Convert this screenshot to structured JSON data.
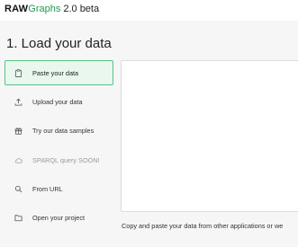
{
  "header": {
    "brand_raw": "RAW",
    "brand_graphs": "Graphs",
    "version": "2.0 beta"
  },
  "section": {
    "title": "1. Load your data"
  },
  "menu": {
    "items": [
      {
        "label": "Paste your data",
        "icon": "clipboard-icon",
        "state": "active"
      },
      {
        "label": "Upload your data",
        "icon": "upload-icon",
        "state": "normal"
      },
      {
        "label": "Try our data samples",
        "icon": "gift-icon",
        "state": "normal"
      },
      {
        "label": "SPARQL query SOON!",
        "icon": "cloud-icon",
        "state": "disabled"
      },
      {
        "label": "From URL",
        "icon": "search-icon",
        "state": "normal"
      },
      {
        "label": "Open your project",
        "icon": "folder-icon",
        "state": "normal"
      }
    ]
  },
  "data_area": {
    "value": "",
    "helper_text": "Copy and paste your data from other applications or we"
  },
  "colors": {
    "brand_green": "#1f9a4c",
    "active_bg": "#e9f7ee",
    "active_border": "#57c383"
  }
}
